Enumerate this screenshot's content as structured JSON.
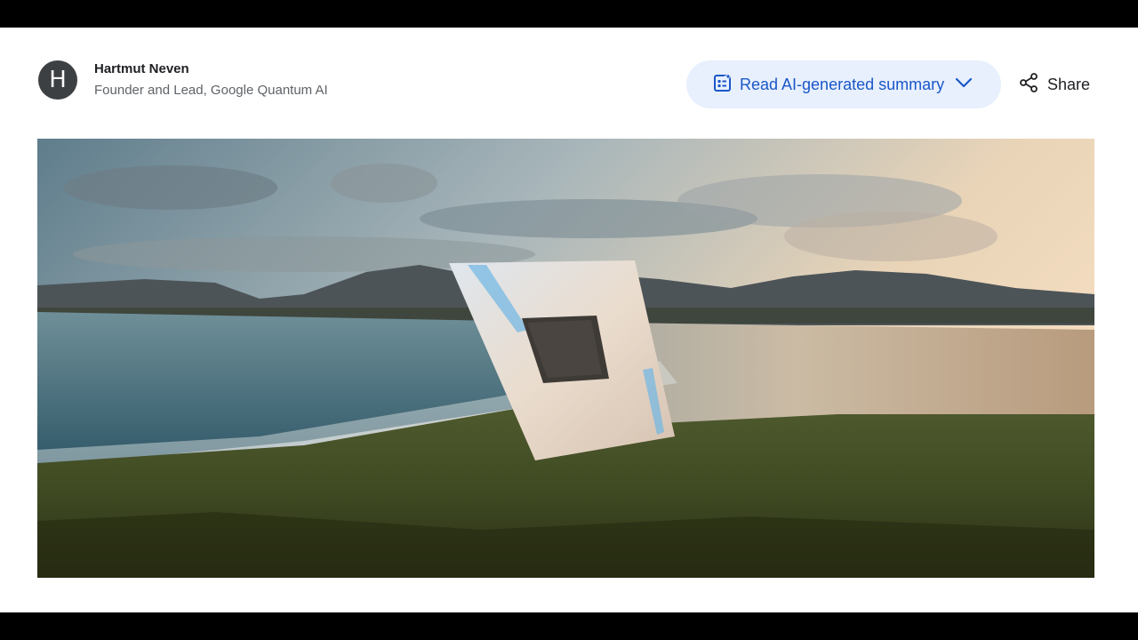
{
  "author": {
    "avatar_initial": "H",
    "name": "Hartmut Neven",
    "role": "Founder and Lead, Google Quantum AI"
  },
  "actions": {
    "summary_label": "Read AI-generated summary",
    "summary_icon": "ai-summary-icon",
    "share_label": "Share",
    "share_icon": "share-icon"
  },
  "colors": {
    "accent": "#1a57c8",
    "summary_bg": "#e8f0fe",
    "avatar_bg": "#3c4043"
  }
}
